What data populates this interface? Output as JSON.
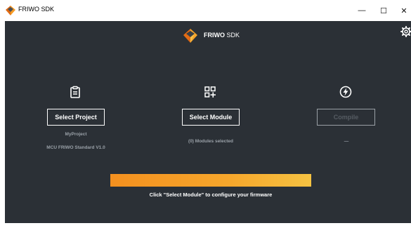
{
  "window": {
    "title": "FRIWO SDK",
    "minimize_glyph": "—",
    "maximize_glyph": "☐",
    "close_glyph": "✕"
  },
  "header": {
    "brand_bold": "FRIWO",
    "brand_rest": " SDK",
    "logo_icon": "friwo-logo-icon",
    "settings_icon": "gear-icon"
  },
  "columns": [
    {
      "icon": "clipboard-icon",
      "button_label": "Select Project",
      "enabled": true,
      "lines": [
        "MyProject",
        "MCU FRIWO Standard V1.0"
      ]
    },
    {
      "icon": "add-module-icon",
      "button_label": "Select Module",
      "enabled": true,
      "lines": [
        "(0) Modules selected"
      ]
    },
    {
      "icon": "lightning-circle-icon",
      "button_label": "Compile",
      "enabled": false,
      "lines": [
        "—"
      ]
    }
  ],
  "progress": {
    "value": 1.0
  },
  "hint": "Click \"Select Module\" to configure your firmware",
  "colors": {
    "background": "#2b3036",
    "accent_start": "#f4901f",
    "accent_end": "#f5c242",
    "text": "#ffffff",
    "muted": "#9aa1a8"
  }
}
